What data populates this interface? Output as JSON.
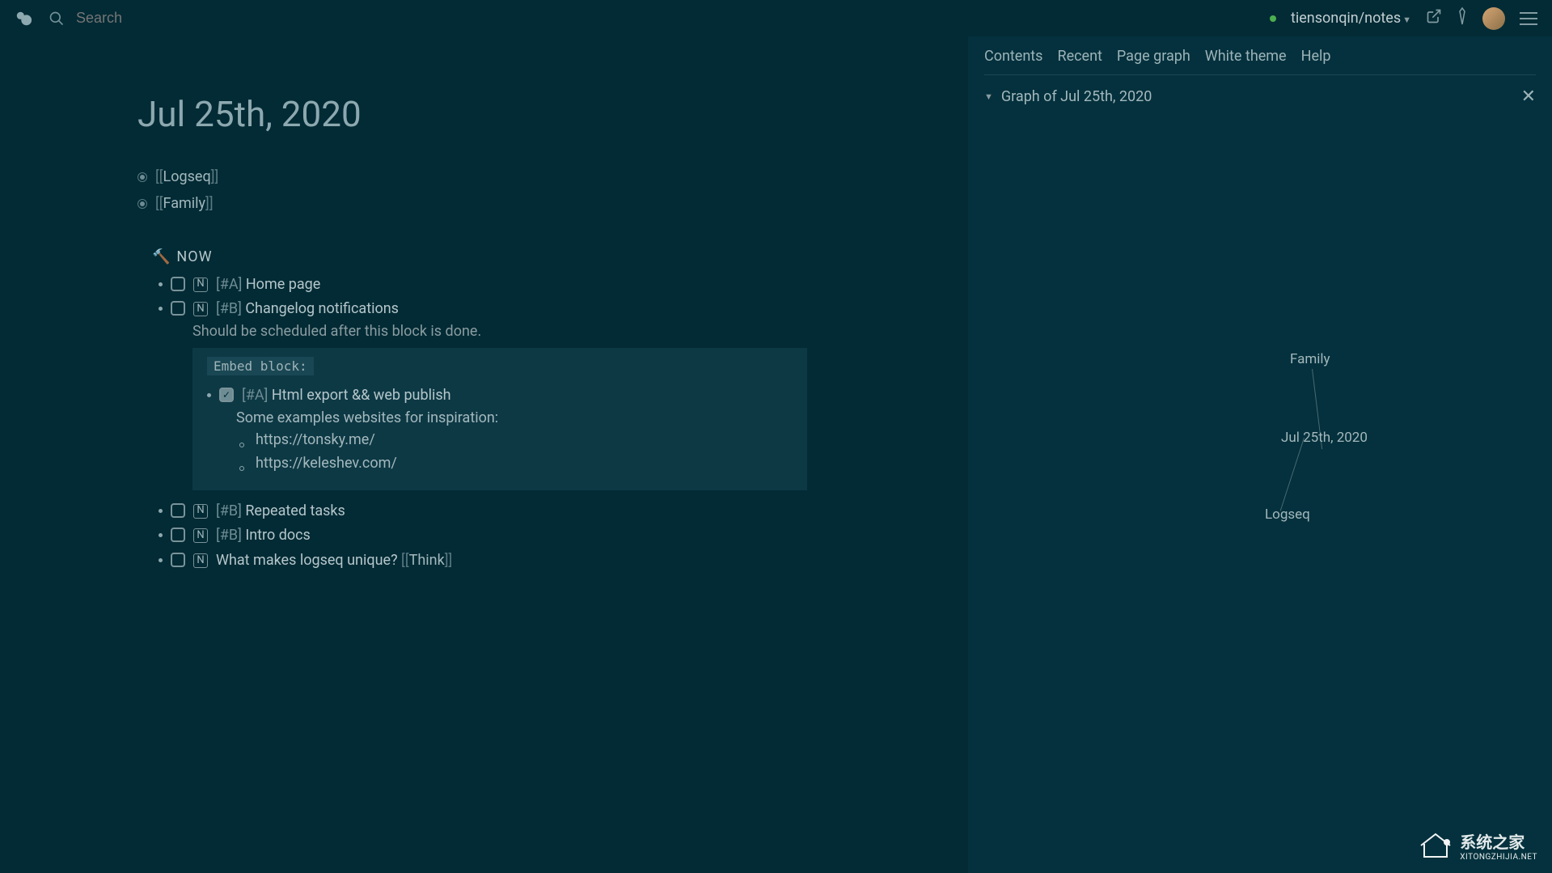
{
  "header": {
    "search_placeholder": "Search",
    "repo": "tiensonqin/notes"
  },
  "page": {
    "title": "Jul 25th, 2020",
    "refs": [
      {
        "name": "Logseq"
      },
      {
        "name": "Family"
      }
    ],
    "section": {
      "label": "NOW",
      "tasks": [
        {
          "priority": "[#A]",
          "text": "Home page"
        },
        {
          "priority": "[#B]",
          "text": "Changelog notifications",
          "sub": "Should be scheduled after this block is done.",
          "embed": {
            "tag": "Embed block:",
            "priority": "[#A]",
            "text": "Html export && web publish",
            "desc": "Some examples websites for inspiration:",
            "links": [
              "https://tonsky.me/",
              "https://keleshev.com/"
            ]
          }
        },
        {
          "priority": "[#B]",
          "text": "Repeated tasks"
        },
        {
          "priority": "[#B]",
          "text": "Intro docs"
        },
        {
          "priority": "",
          "text": "What makes logseq unique? ",
          "ref": "Think"
        }
      ]
    }
  },
  "sidebar": {
    "tabs": [
      "Contents",
      "Recent",
      "Page graph",
      "White theme",
      "Help"
    ],
    "title": "Graph of Jul 25th, 2020",
    "nodes": {
      "family": "Family",
      "center": "Jul 25th, 2020",
      "logseq": "Logseq"
    }
  },
  "watermark": {
    "cn": "系统之家",
    "en": "XITONGZHIJIA.NET"
  }
}
